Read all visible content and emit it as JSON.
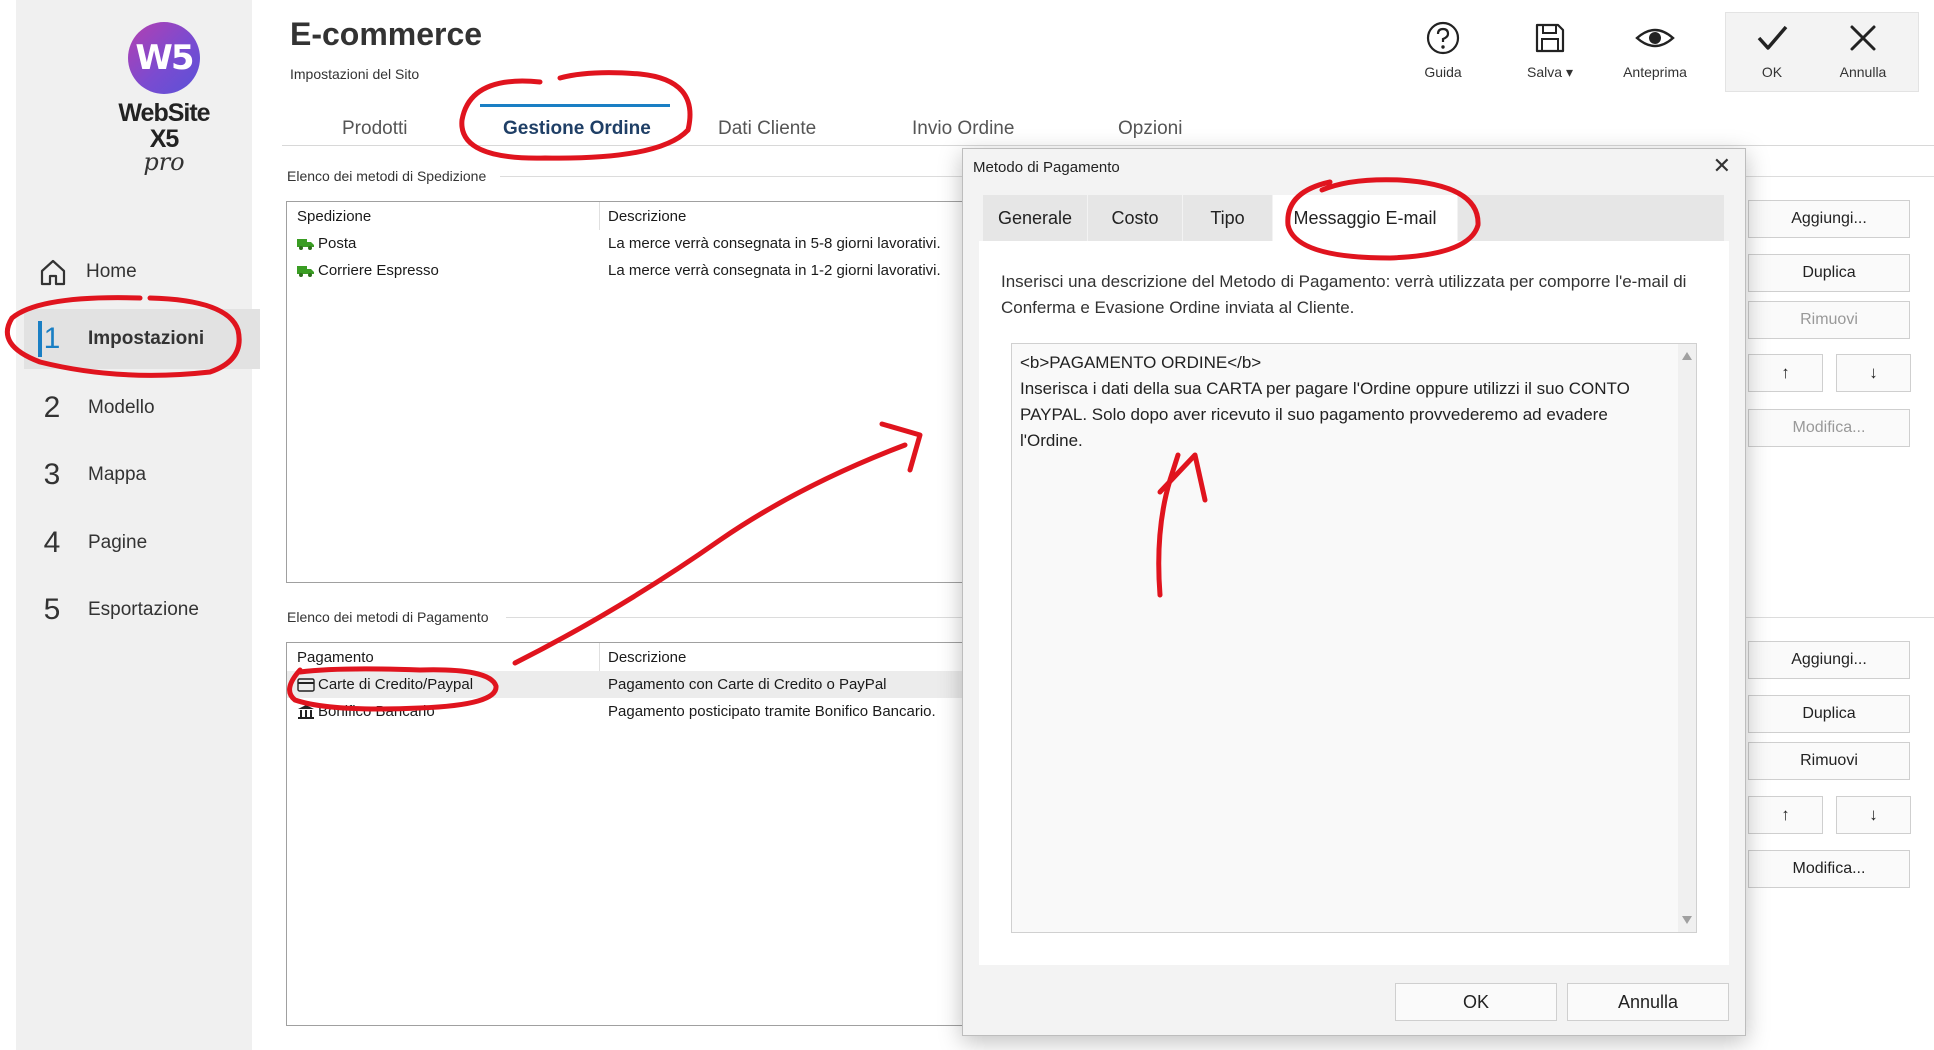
{
  "app": {
    "logo_text": "W5",
    "brand": "WebSite X5",
    "edition": "pro"
  },
  "sidebar": {
    "home_label": "Home",
    "items": [
      {
        "num": "1",
        "label": "Impostazioni",
        "active": true
      },
      {
        "num": "2",
        "label": "Modello"
      },
      {
        "num": "3",
        "label": "Mappa"
      },
      {
        "num": "4",
        "label": "Pagine"
      },
      {
        "num": "5",
        "label": "Esportazione"
      }
    ]
  },
  "header": {
    "title": "E-commerce",
    "subtitle": "Impostazioni del Sito",
    "toolbar": {
      "guida": "Guida",
      "salva": "Salva ▾",
      "anteprima": "Anteprima",
      "ok": "OK",
      "annulla": "Annulla"
    }
  },
  "main_tabs": [
    "Prodotti",
    "Gestione Ordine",
    "Dati Cliente",
    "Invio Ordine",
    "Opzioni"
  ],
  "shipping": {
    "section_title": "Elenco dei metodi di Spedizione",
    "col1": "Spedizione",
    "col2": "Descrizione",
    "rows": [
      {
        "name": "Posta",
        "desc": "La merce verrà consegnata in 5-8 giorni lavorativi."
      },
      {
        "name": "Corriere Espresso",
        "desc": "La merce verrà consegnata in 1-2 giorni lavorativi."
      }
    ],
    "buttons": {
      "add": "Aggiungi...",
      "dup": "Duplica",
      "remove": "Rimuovi",
      "up": "↑",
      "down": "↓",
      "edit": "Modifica..."
    }
  },
  "payment": {
    "section_title": "Elenco dei metodi di Pagamento",
    "col1": "Pagamento",
    "col2": "Descrizione",
    "rows": [
      {
        "name": "Carte di Credito/Paypal",
        "desc": "Pagamento con Carte di Credito o PayPal"
      },
      {
        "name": "Bonifico Bancario",
        "desc": "Pagamento posticipato tramite Bonifico Bancario."
      }
    ],
    "buttons": {
      "add": "Aggiungi...",
      "dup": "Duplica",
      "remove": "Rimuovi",
      "up": "↑",
      "down": "↓",
      "edit": "Modifica..."
    }
  },
  "dialog": {
    "title": "Metodo di Pagamento",
    "close": "✕",
    "tabs": [
      "Generale",
      "Costo",
      "Tipo",
      "Messaggio E-mail"
    ],
    "description": "Inserisci una descrizione del Metodo di Pagamento: verrà utilizzata per comporre l'e-mail di Conferma e Evasione Ordine inviata al Cliente.",
    "editor_text": "<b>PAGAMENTO ORDINE</b>\nInserisca i dati della sua CARTA per pagare l'Ordine oppure utilizzi il suo CONTO PAYPAL. Solo dopo aver ricevuto il suo pagamento provvederemo ad evadere l'Ordine.",
    "ok": "OK",
    "cancel": "Annulla"
  },
  "colors": {
    "accent": "#1a7fc4",
    "annotation": "#e0141e"
  }
}
